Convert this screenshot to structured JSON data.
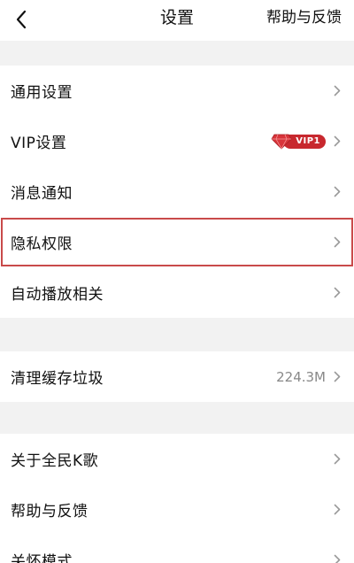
{
  "header": {
    "title": "设置",
    "help_label": "帮助与反馈"
  },
  "groups": [
    {
      "items": [
        {
          "label": "通用设置"
        },
        {
          "label": "VIP设置",
          "badge": "VIP1"
        },
        {
          "label": "消息通知"
        },
        {
          "label": "隐私权限",
          "highlighted": true
        },
        {
          "label": "自动播放相关"
        }
      ]
    },
    {
      "items": [
        {
          "label": "清理缓存垃圾",
          "value": "224.3M"
        }
      ]
    },
    {
      "items": [
        {
          "label": "关于全民K歌"
        },
        {
          "label": "帮助与反馈"
        },
        {
          "label": "关怀模式"
        }
      ]
    }
  ],
  "colors": {
    "highlight_border": "#c94a4a",
    "vip_badge": "#c8282e"
  }
}
